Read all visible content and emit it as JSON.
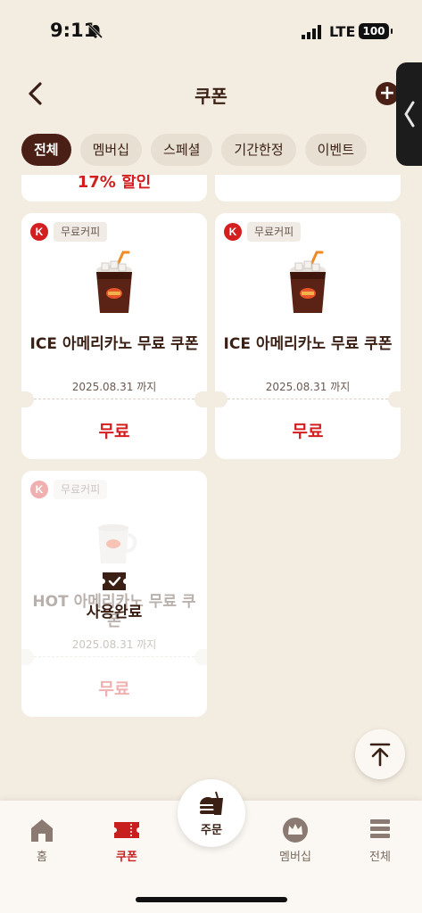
{
  "status_bar": {
    "time": "9:11",
    "network": "LTE",
    "battery": "100"
  },
  "header": {
    "title": "쿠폰"
  },
  "tabs": [
    {
      "label": "전체",
      "active": true
    },
    {
      "label": "멤버십",
      "active": false
    },
    {
      "label": "스페셜",
      "active": false
    },
    {
      "label": "기간한정",
      "active": false
    },
    {
      "label": "이벤트",
      "active": false
    }
  ],
  "partial_cards": [
    {
      "discount": "17% 할인"
    },
    {
      "discount": ""
    }
  ],
  "coupons": [
    {
      "badge": "무료커피",
      "name": "ICE 아메리카노 무료 쿠폰",
      "date": "2025.08.31 까지",
      "price": "무료",
      "status": ""
    },
    {
      "badge": "무료커피",
      "name": "ICE 아메리카노 무료 쿠폰",
      "date": "2025.08.31 까지",
      "price": "무료",
      "status": ""
    },
    {
      "badge": "무료커피",
      "name": "HOT 아메리카노 무료 쿠폰",
      "date": "2025.08.31 까지",
      "price": "무료",
      "status": "사용완료"
    }
  ],
  "brand_logo_letter": "K",
  "bottom_nav": {
    "home": "홈",
    "coupon": "쿠폰",
    "order": "주문",
    "membership": "멤버십",
    "all": "전체"
  },
  "colors": {
    "brand": "#4a2016",
    "accent_red": "#d31f1f",
    "background": "#f3ece1"
  }
}
